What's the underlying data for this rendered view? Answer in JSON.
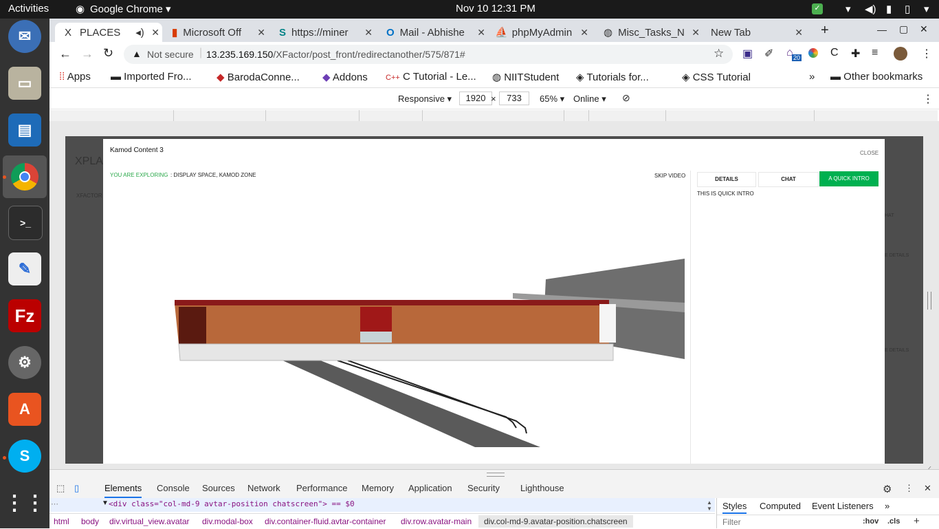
{
  "os": {
    "activities": "Activities",
    "app": "Google Chrome",
    "clock": "Nov 10  12:31 PM"
  },
  "tabs": [
    {
      "label": "PLACES"
    },
    {
      "label": "Microsoft Off"
    },
    {
      "label": "https://miner"
    },
    {
      "label": "Mail - Abhishe"
    },
    {
      "label": "phpMyAdmin"
    },
    {
      "label": "Misc_Tasks_N"
    },
    {
      "label": "New Tab"
    }
  ],
  "address": {
    "security": "Not secure",
    "host": "13.235.169.150",
    "path": "/XFactor/post_front/redirectanother/575/871#"
  },
  "bookmarks": [
    {
      "label": "Apps"
    },
    {
      "label": "Imported Fro..."
    },
    {
      "label": "BarodaConne..."
    },
    {
      "label": "Addons"
    },
    {
      "label": "C Tutorial - Le..."
    },
    {
      "label": "NIITStudent"
    },
    {
      "label": "Tutorials for..."
    },
    {
      "label": "CSS Tutorial"
    },
    {
      "label": "»"
    },
    {
      "label": "Other bookmarks"
    }
  ],
  "device_toolbar": {
    "mode": "Responsive",
    "width": "1920",
    "times": "×",
    "height": "733",
    "zoom": "65%",
    "network": "Online"
  },
  "page": {
    "bg_title": "XPLA",
    "bg_nav": "XFACTOR",
    "bg_details_1": "E DETAILS",
    "bg_details_2": "E DETAILS",
    "bg_chat": "HAT"
  },
  "modal": {
    "title": "Kamod Content 3",
    "close": "CLOSE",
    "exploring_label": "YOU ARE EXPLORING",
    "exploring_value": ": DISPLAY SPACE, KAMOD ZONE",
    "skip": "SKIP VIDEO",
    "tabs": [
      {
        "label": "DETAILS"
      },
      {
        "label": "CHAT"
      },
      {
        "label": "A QUICK INTRO"
      }
    ],
    "intro_text": "THIS IS QUICK INTRO"
  },
  "devtools": {
    "tabs": [
      {
        "label": "Elements"
      },
      {
        "label": "Console"
      },
      {
        "label": "Sources"
      },
      {
        "label": "Network"
      },
      {
        "label": "Performance"
      },
      {
        "label": "Memory"
      },
      {
        "label": "Application"
      },
      {
        "label": "Security"
      },
      {
        "label": "Lighthouse"
      }
    ],
    "dom_line": "<div class=\"col-md-9 avtar-position chatscreen\"> == $0",
    "breadcrumbs": [
      {
        "label": "html"
      },
      {
        "label": "body"
      },
      {
        "label": "div.virtual_view.avatar"
      },
      {
        "label": "div.modal-box"
      },
      {
        "label": "div.container-fluid.avtar-container"
      },
      {
        "label": "div.row.avatar-main"
      },
      {
        "label": "div.col-md-9.avatar-position.chatscreen"
      }
    ],
    "styles_tabs": [
      {
        "label": "Styles"
      },
      {
        "label": "Computed"
      },
      {
        "label": "Event Listeners"
      },
      {
        "label": "»"
      }
    ],
    "filter_placeholder": "Filter",
    "hov": ":hov",
    "cls": ".cls",
    "plus": "+"
  },
  "colors": {
    "accent_green": "#00b050",
    "explore_green": "#2aa84a",
    "devtools_blue": "#1a73e8",
    "ubuntu_orange": "#e95420"
  }
}
